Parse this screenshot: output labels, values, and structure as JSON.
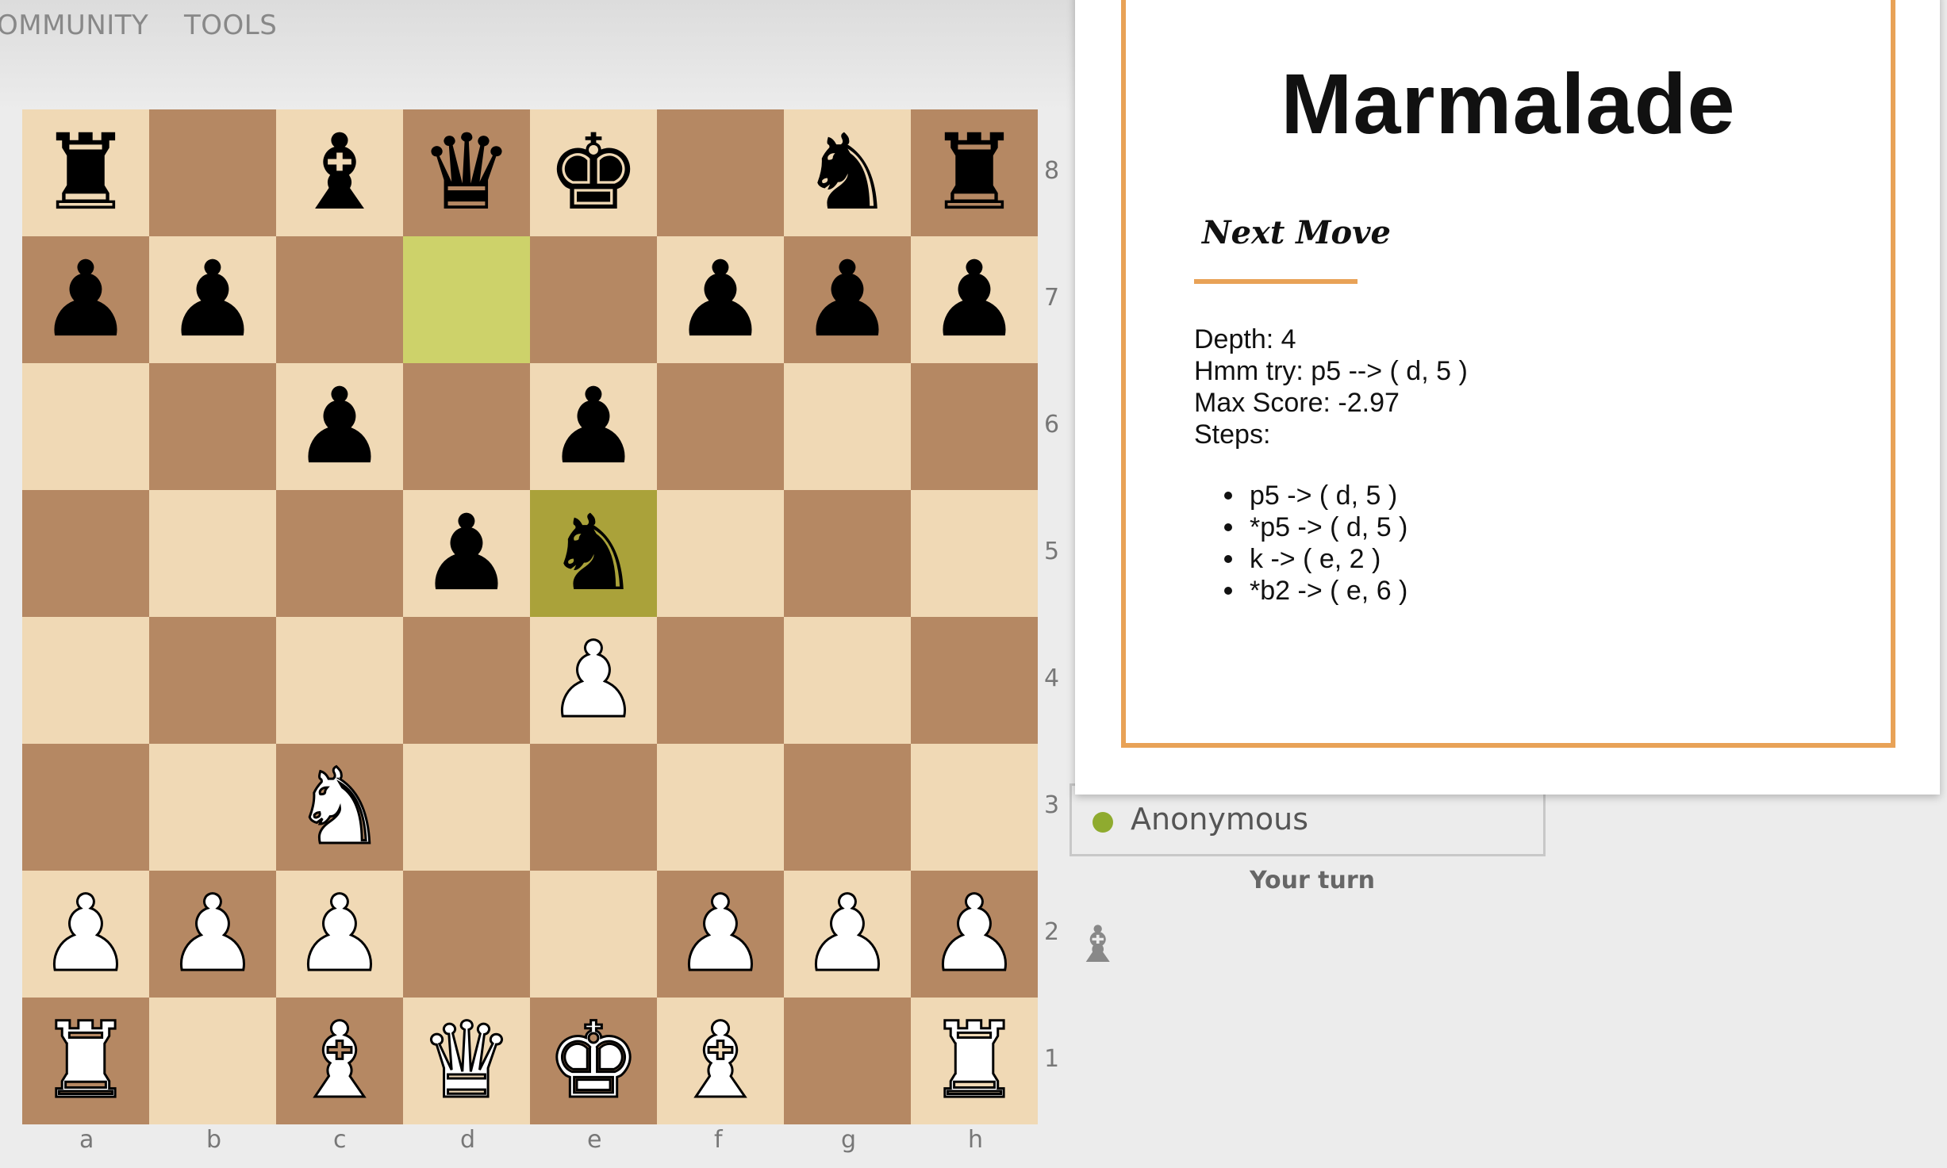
{
  "nav": {
    "items": [
      "OMMUNITY",
      "TOOLS"
    ]
  },
  "board": {
    "files": [
      "a",
      "b",
      "c",
      "d",
      "e",
      "f",
      "g",
      "h"
    ],
    "ranks": [
      "8",
      "7",
      "6",
      "5",
      "4",
      "3",
      "2",
      "1"
    ],
    "light_color": "#f0d9b5",
    "dark_color": "#b58863",
    "highlight_from": "d7",
    "highlight_to": "e5",
    "pieces": [
      {
        "square": "a8",
        "type": "rook",
        "color": "black"
      },
      {
        "square": "c8",
        "type": "bishop",
        "color": "black"
      },
      {
        "square": "d8",
        "type": "queen",
        "color": "black"
      },
      {
        "square": "e8",
        "type": "king",
        "color": "black"
      },
      {
        "square": "g8",
        "type": "knight",
        "color": "black"
      },
      {
        "square": "h8",
        "type": "rook",
        "color": "black"
      },
      {
        "square": "a7",
        "type": "pawn",
        "color": "black"
      },
      {
        "square": "b7",
        "type": "pawn",
        "color": "black"
      },
      {
        "square": "f7",
        "type": "pawn",
        "color": "black"
      },
      {
        "square": "g7",
        "type": "pawn",
        "color": "black"
      },
      {
        "square": "h7",
        "type": "pawn",
        "color": "black"
      },
      {
        "square": "c6",
        "type": "pawn",
        "color": "black"
      },
      {
        "square": "e6",
        "type": "pawn",
        "color": "black"
      },
      {
        "square": "d5",
        "type": "pawn",
        "color": "black"
      },
      {
        "square": "e5",
        "type": "knight",
        "color": "black"
      },
      {
        "square": "e4",
        "type": "pawn",
        "color": "white"
      },
      {
        "square": "c3",
        "type": "knight",
        "color": "white"
      },
      {
        "square": "a2",
        "type": "pawn",
        "color": "white"
      },
      {
        "square": "b2",
        "type": "pawn",
        "color": "white"
      },
      {
        "square": "c2",
        "type": "pawn",
        "color": "white"
      },
      {
        "square": "f2",
        "type": "pawn",
        "color": "white"
      },
      {
        "square": "g2",
        "type": "pawn",
        "color": "white"
      },
      {
        "square": "h2",
        "type": "pawn",
        "color": "white"
      },
      {
        "square": "a1",
        "type": "rook",
        "color": "white"
      },
      {
        "square": "c1",
        "type": "bishop",
        "color": "white"
      },
      {
        "square": "d1",
        "type": "queen",
        "color": "white"
      },
      {
        "square": "e1",
        "type": "king",
        "color": "white"
      },
      {
        "square": "f1",
        "type": "bishop",
        "color": "white"
      },
      {
        "square": "h1",
        "type": "rook",
        "color": "white"
      }
    ]
  },
  "player": {
    "name": "Anonymous",
    "status_color": "#8fab2f"
  },
  "turn_text": "Your turn",
  "turn_icon": "bishop-icon",
  "panel": {
    "title": "Marmalade",
    "subtitle": "Next Move",
    "accent_color": "#e8a257",
    "depth": "Depth: 4",
    "hmm": "Hmm try: p5 --> ( d, 5 )",
    "max_score": "Max Score: -2.97",
    "steps_label": "Steps:",
    "steps": [
      "p5 -> ( d, 5 )",
      "*p5 -> ( d, 5 )",
      "k -> ( e, 2 )",
      "*b2 -> ( e, 6 )"
    ]
  }
}
